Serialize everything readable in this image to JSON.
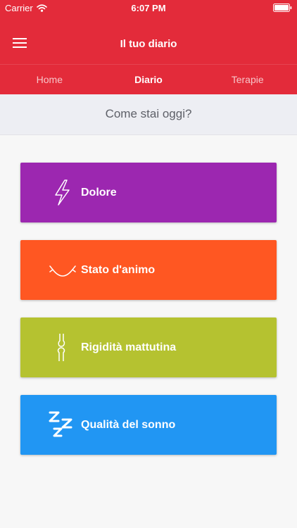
{
  "status_bar": {
    "carrier": "Carrier",
    "time": "6:07 PM"
  },
  "header": {
    "title": "Il tuo diario"
  },
  "tabs": [
    {
      "label": "Home",
      "active": false
    },
    {
      "label": "Diario",
      "active": true
    },
    {
      "label": "Terapie",
      "active": false
    }
  ],
  "question": "Come stai oggi?",
  "cards": [
    {
      "label": "Dolore",
      "icon": "lightning-icon",
      "color": "#9c27b0"
    },
    {
      "label": "Stato d'animo",
      "icon": "smile-icon",
      "color": "#ff5722"
    },
    {
      "label": "Rigidità mattutina",
      "icon": "joint-icon",
      "color": "#b5c230"
    },
    {
      "label": "Qualità del sonno",
      "icon": "zzz-icon",
      "color": "#2196f3"
    }
  ],
  "colors": {
    "primary": "#e32b3a",
    "question_bg": "#edeef3"
  }
}
